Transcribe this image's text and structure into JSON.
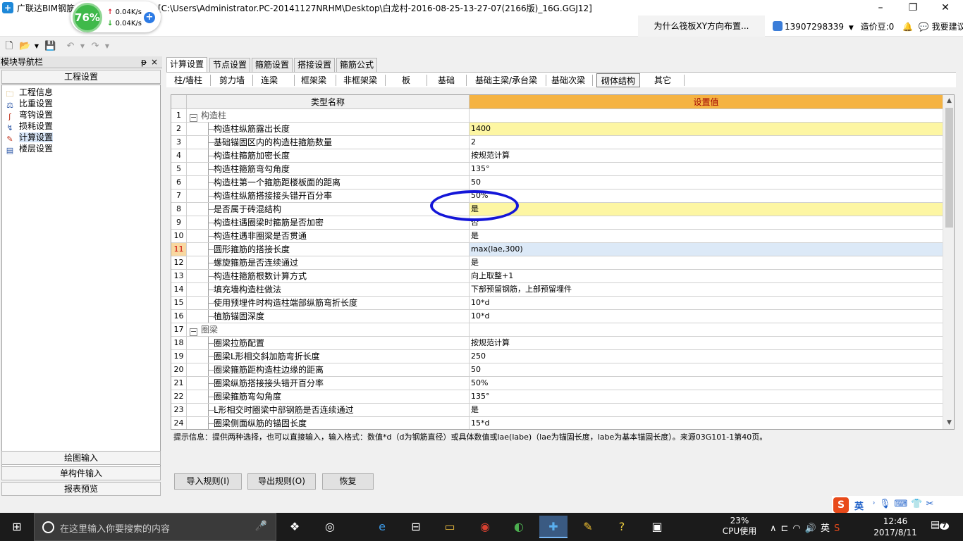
{
  "window": {
    "app_title": "广联达BIM钢筋",
    "path": "[C:\\Users\\Administrator.PC-20141127NRHM\\Desktop\\白龙村-2016-08-25-13-27-07(2166版)_16G.GGJ12]",
    "minimize": "–",
    "maximize": "❐",
    "close": "✕"
  },
  "speed_widget": {
    "percent": "76%",
    "up": "0.04K/s",
    "down": "0.04K/s"
  },
  "infobar": {
    "hint": "为什么筏板XY方向布置...",
    "phone": "13907298339",
    "bean": "造价豆:0",
    "suggest": "我要建议"
  },
  "leftnav": {
    "title": "模块导航栏",
    "pin": "ᵽ",
    "close": "×",
    "section": "工程设置",
    "items": [
      {
        "label": "工程信息"
      },
      {
        "label": "比重设置"
      },
      {
        "label": "弯钩设置"
      },
      {
        "label": "损耗设置"
      },
      {
        "label": "计算设置"
      },
      {
        "label": "楼层设置"
      }
    ],
    "bottom": [
      "绘图输入",
      "单构件输入",
      "报表预览"
    ]
  },
  "tabs1": [
    "计算设置",
    "节点设置",
    "箍筋设置",
    "搭接设置",
    "箍筋公式"
  ],
  "tabs2": [
    "柱/墙柱",
    "剪力墙",
    "连梁",
    "框架梁",
    "非框架梁",
    "板",
    "基础",
    "基础主梁/承台梁",
    "基础次梁",
    "砌体结构",
    "其它"
  ],
  "grid": {
    "col_name": "类型名称",
    "col_value": "设置值",
    "rows": [
      {
        "n": "1",
        "name": "构造柱",
        "value": ""
      },
      {
        "n": "2",
        "name": "构造柱纵筋露出长度",
        "value": "1400"
      },
      {
        "n": "3",
        "name": "基础锚固区内的构造柱箍筋数量",
        "value": "2"
      },
      {
        "n": "4",
        "name": "构造柱箍筋加密长度",
        "value": "按规范计算"
      },
      {
        "n": "5",
        "name": "构造柱箍筋弯勾角度",
        "value": "135°"
      },
      {
        "n": "6",
        "name": "构造柱第一个箍筋距楼板面的距离",
        "value": "50"
      },
      {
        "n": "7",
        "name": "构造柱纵筋搭接接头错开百分率",
        "value": "50%"
      },
      {
        "n": "8",
        "name": "是否属于砖混结构",
        "value": "是"
      },
      {
        "n": "9",
        "name": "构造柱遇圈梁时箍筋是否加密",
        "value": "否"
      },
      {
        "n": "10",
        "name": "构造柱遇非圈梁是否贯通",
        "value": "是"
      },
      {
        "n": "11",
        "name": "圆形箍筋的搭接长度",
        "value": "max(lae,300)"
      },
      {
        "n": "12",
        "name": "螺旋箍筋是否连续通过",
        "value": "是"
      },
      {
        "n": "13",
        "name": "构造柱箍筋根数计算方式",
        "value": "向上取整+1"
      },
      {
        "n": "14",
        "name": "填充墙构造柱做法",
        "value": "下部预留钢筋，上部预留埋件"
      },
      {
        "n": "15",
        "name": "使用预埋件时构造柱端部纵筋弯折长度",
        "value": "10*d"
      },
      {
        "n": "16",
        "name": "植筋锚固深度",
        "value": "10*d"
      },
      {
        "n": "17",
        "name": "圈梁",
        "value": ""
      },
      {
        "n": "18",
        "name": "圈梁拉筋配置",
        "value": "按规范计算"
      },
      {
        "n": "19",
        "name": "圈梁L形相交斜加筋弯折长度",
        "value": "250"
      },
      {
        "n": "20",
        "name": "圈梁箍筋距构造柱边缘的距离",
        "value": "50"
      },
      {
        "n": "21",
        "name": "圈梁纵筋搭接接头错开百分率",
        "value": "50%"
      },
      {
        "n": "22",
        "name": "圈梁箍筋弯勾角度",
        "value": "135°"
      },
      {
        "n": "23",
        "name": "L形相交时圈梁中部钢筋是否连续通过",
        "value": "是"
      },
      {
        "n": "24",
        "name": "圈梁侧面纵筋的锚固长度",
        "value": "15*d"
      }
    ]
  },
  "tip": "提示信息：提供两种选择，也可以直接输入，输入格式：数值*d（d为钢筋直径）或具体数值或lae(labe)（lae为锚固长度，labe为基本锚固长度）。来源03G101-1第40页。",
  "buttons": {
    "import": "导入规则(I)",
    "export": "导出规则(O)",
    "restore": "恢复"
  },
  "ime": {
    "s": "S",
    "lang": "英"
  },
  "taskbar": {
    "search_placeholder": "在这里输入你要搜索的内容",
    "cpu_pct": "23%",
    "cpu_label": "CPU使用",
    "lang": "英",
    "time": "12:46",
    "date": "2017/8/11",
    "notif_count": "7"
  }
}
